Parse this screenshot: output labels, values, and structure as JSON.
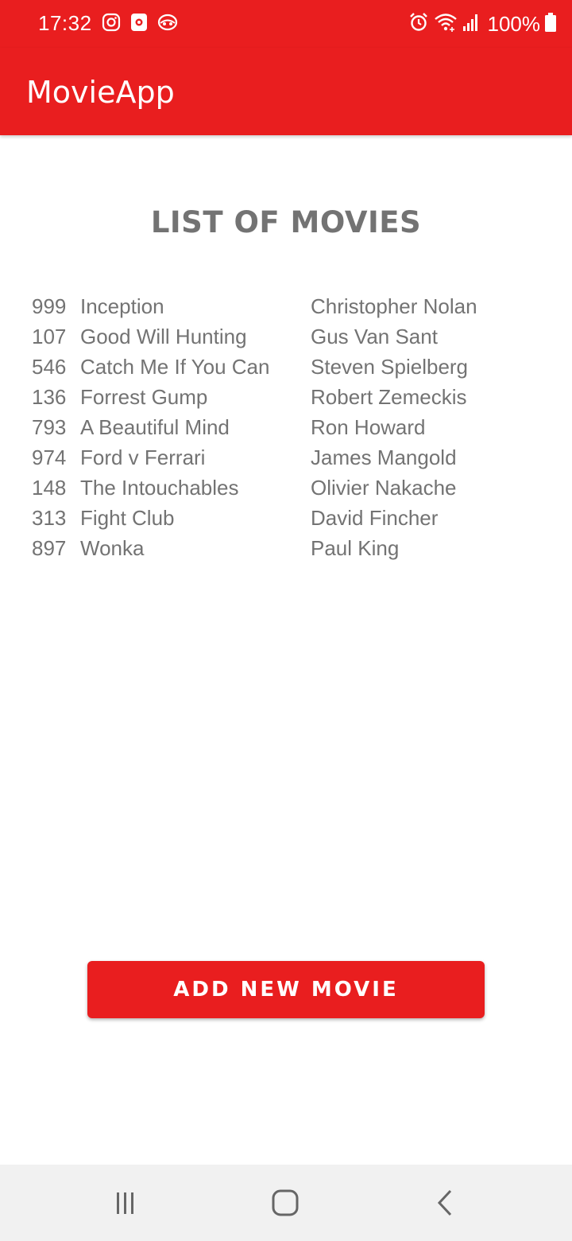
{
  "status_bar": {
    "time": "17:32",
    "left_icons": [
      "instagram-icon",
      "notification-app-icon",
      "vpn-icon"
    ],
    "right_icons": [
      "alarm-icon",
      "wifi-icon",
      "signal-icon"
    ],
    "battery": "100%"
  },
  "app_bar": {
    "title": "MovieApp"
  },
  "main": {
    "heading": "LIST OF MOVIES",
    "movies": [
      {
        "id": "999",
        "title": "Inception",
        "director": "Christopher Nolan"
      },
      {
        "id": "107",
        "title": "Good Will Hunting",
        "director": "Gus Van Sant"
      },
      {
        "id": "546",
        "title": "Catch Me If You Can",
        "director": "Steven Spielberg"
      },
      {
        "id": "136",
        "title": "Forrest Gump",
        "director": "Robert Zemeckis"
      },
      {
        "id": "793",
        "title": "A Beautiful Mind",
        "director": "Ron Howard"
      },
      {
        "id": "974",
        "title": "Ford v Ferrari",
        "director": "James Mangold"
      },
      {
        "id": "148",
        "title": "The Intouchables",
        "director": "Olivier Nakache"
      },
      {
        "id": "313",
        "title": "Fight Club",
        "director": "David Fincher"
      },
      {
        "id": "897",
        "title": "Wonka",
        "director": "Paul King"
      }
    ],
    "add_button_label": "ADD NEW MOVIE"
  },
  "nav_bar": {
    "buttons": [
      "recent-apps-icon",
      "home-icon",
      "back-icon"
    ]
  },
  "colors": {
    "accent": "#e91e1f",
    "text": "#737373",
    "nav_background": "#f1f1f1"
  }
}
